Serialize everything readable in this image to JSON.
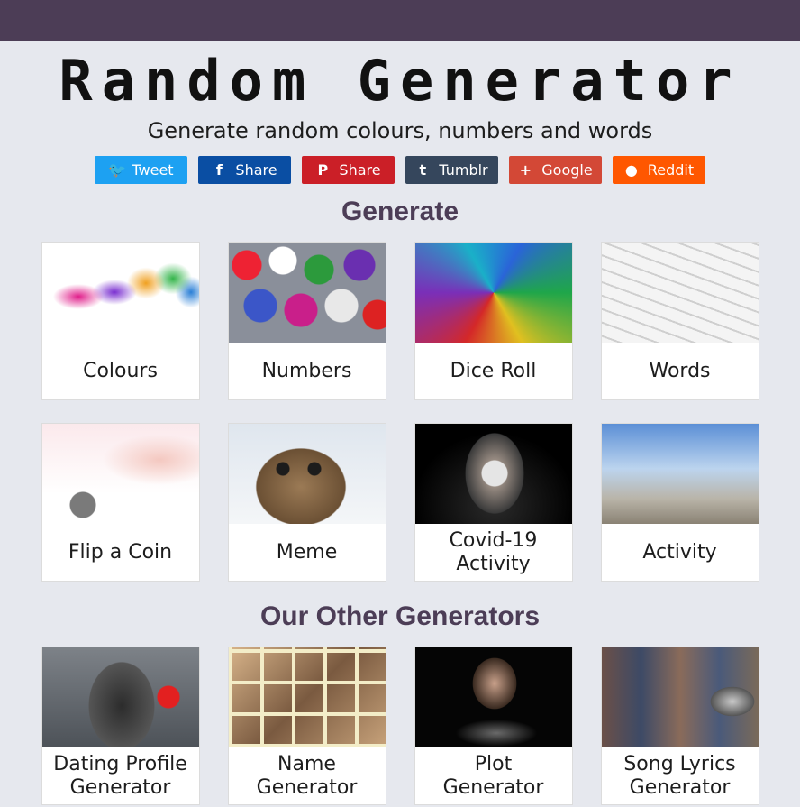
{
  "header": {
    "title": "Random Generator",
    "tagline": "Generate random colours, numbers and words"
  },
  "share_buttons": [
    {
      "label": "Tweet",
      "icon": "twitter-icon",
      "glyph": "🐦",
      "color": "#1da1f2"
    },
    {
      "label": "Share",
      "icon": "facebook-icon",
      "glyph": "f",
      "color": "#0a4ea3"
    },
    {
      "label": "Share",
      "icon": "pinterest-icon",
      "glyph": "P",
      "color": "#cb1f27"
    },
    {
      "label": "Tumblr",
      "icon": "tumblr-icon",
      "glyph": "t",
      "color": "#35465c"
    },
    {
      "label": "Google",
      "icon": "plus-icon",
      "glyph": "+",
      "color": "#d34836"
    },
    {
      "label": "Reddit",
      "icon": "reddit-icon",
      "glyph": "●",
      "color": "#ff5700"
    }
  ],
  "sections": {
    "generate": {
      "title": "Generate",
      "cards": [
        {
          "label": "Colours"
        },
        {
          "label": "Numbers"
        },
        {
          "label": "Dice Roll"
        },
        {
          "label": "Words"
        },
        {
          "label": "Flip a Coin"
        },
        {
          "label": "Meme"
        },
        {
          "label": "Covid-19 Activity"
        },
        {
          "label": "Activity"
        }
      ]
    },
    "other": {
      "title": "Our Other Generators",
      "cards": [
        {
          "label": "Dating Profile Generator"
        },
        {
          "label": "Name Generator"
        },
        {
          "label": "Plot Generator"
        },
        {
          "label": "Song Lyrics Generator"
        }
      ]
    }
  },
  "colors": {
    "topbar": "#4c3d56",
    "section_title": "#4c3d56",
    "background": "#e6e8ee"
  }
}
